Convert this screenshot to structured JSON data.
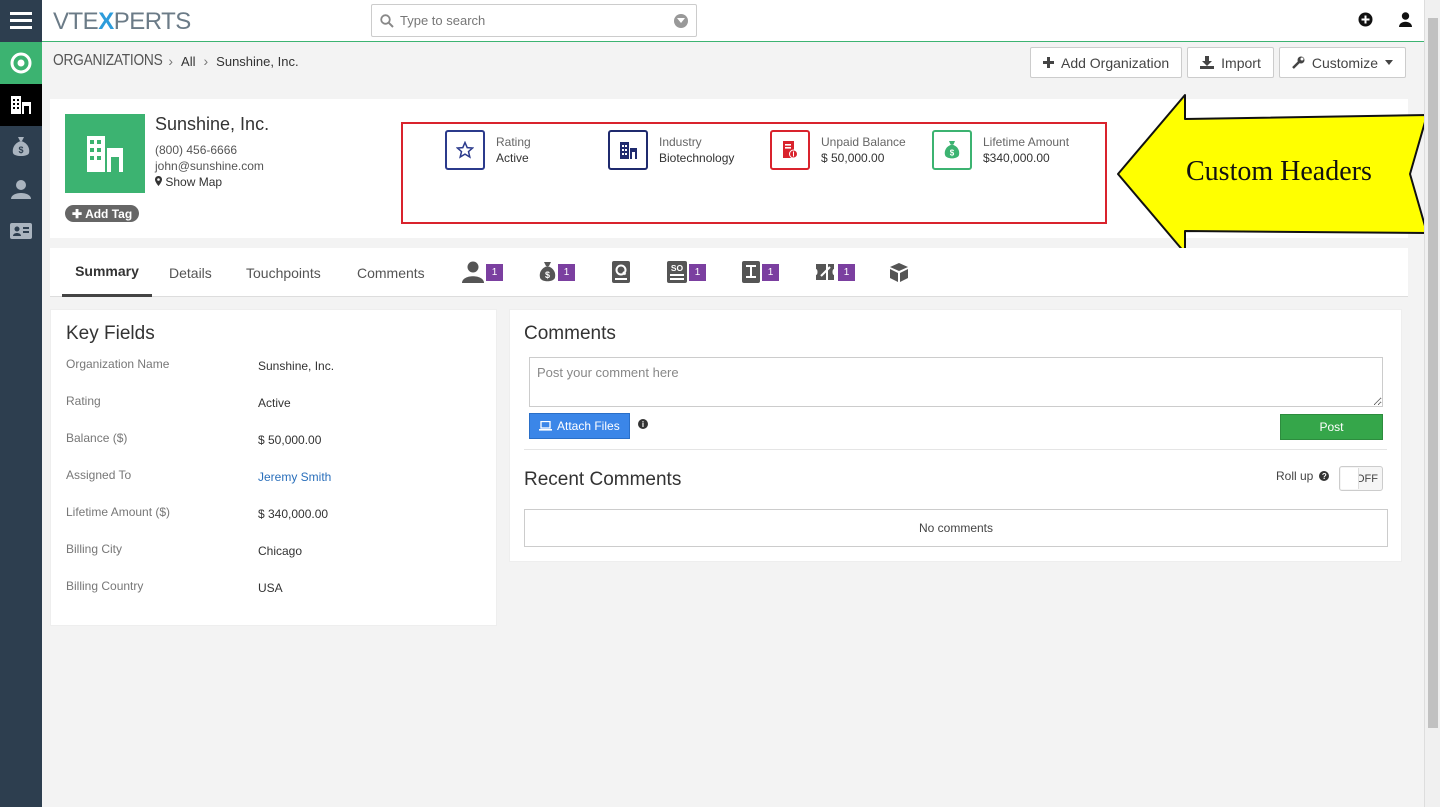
{
  "app": {
    "logo_left": "VTE",
    "logo_x": "X",
    "logo_right": "PERTS"
  },
  "search": {
    "placeholder": "Type to search"
  },
  "breadcrumb": {
    "module": "ORGANIZATIONS",
    "filter": "All",
    "record": "Sunshine, Inc."
  },
  "toolbar": {
    "add_label": "Add Organization",
    "import_label": "Import",
    "customize_label": "Customize"
  },
  "record": {
    "name": "Sunshine, Inc.",
    "phone": "(800) 456-6666",
    "email": "john@sunshine.com",
    "map_label": "Show Map",
    "tag_label": "Add Tag"
  },
  "custom_headers": [
    {
      "label": "Rating",
      "value": "Active",
      "icon": "star-icon",
      "color": "#2b3a8c"
    },
    {
      "label": "Industry",
      "value": "Biotechnology",
      "icon": "building-icon",
      "color": "#1f2a6e"
    },
    {
      "label": "Unpaid Balance",
      "value": "$ 50,000.00",
      "icon": "invoice-icon",
      "color": "#d9232d"
    },
    {
      "label": "Lifetime Amount",
      "value": "$340,000.00",
      "icon": "money-bag-icon",
      "color": "#3cb371"
    }
  ],
  "callout": {
    "text": "Custom Headers",
    "color": "#ffff00"
  },
  "tabs": [
    {
      "label": "Summary",
      "active": true
    },
    {
      "label": "Details"
    },
    {
      "label": "Touchpoints"
    },
    {
      "label": "Comments"
    }
  ],
  "related_badges": {
    "contacts": "1",
    "deals": "1",
    "sales_orders": "1",
    "invoices": "1",
    "tickets": "1"
  },
  "key_fields": {
    "title": "Key Fields",
    "rows": [
      {
        "label": "Organization Name",
        "value": "Sunshine, Inc."
      },
      {
        "label": "Rating",
        "value": "Active"
      },
      {
        "label": "Balance ($)",
        "value": "$ 50,000.00"
      },
      {
        "label": "Assigned To",
        "value": "Jeremy Smith"
      },
      {
        "label": "Lifetime Amount ($)",
        "value": "$ 340,000.00"
      },
      {
        "label": "Billing City",
        "value": "Chicago"
      },
      {
        "label": "Billing Country",
        "value": "USA"
      }
    ]
  },
  "comments": {
    "title": "Comments",
    "placeholder": "Post your comment here",
    "attach_label": "Attach Files",
    "post_label": "Post",
    "recent_title": "Recent Comments",
    "rollup_label": "Roll up",
    "toggle_state": "OFF",
    "empty_text": "No comments"
  },
  "colors": {
    "sidebar": "#2d3e4f",
    "accent": "#3cb371",
    "badge": "#7b3fa0",
    "attach": "#3b86e8",
    "post": "#35a64a"
  }
}
